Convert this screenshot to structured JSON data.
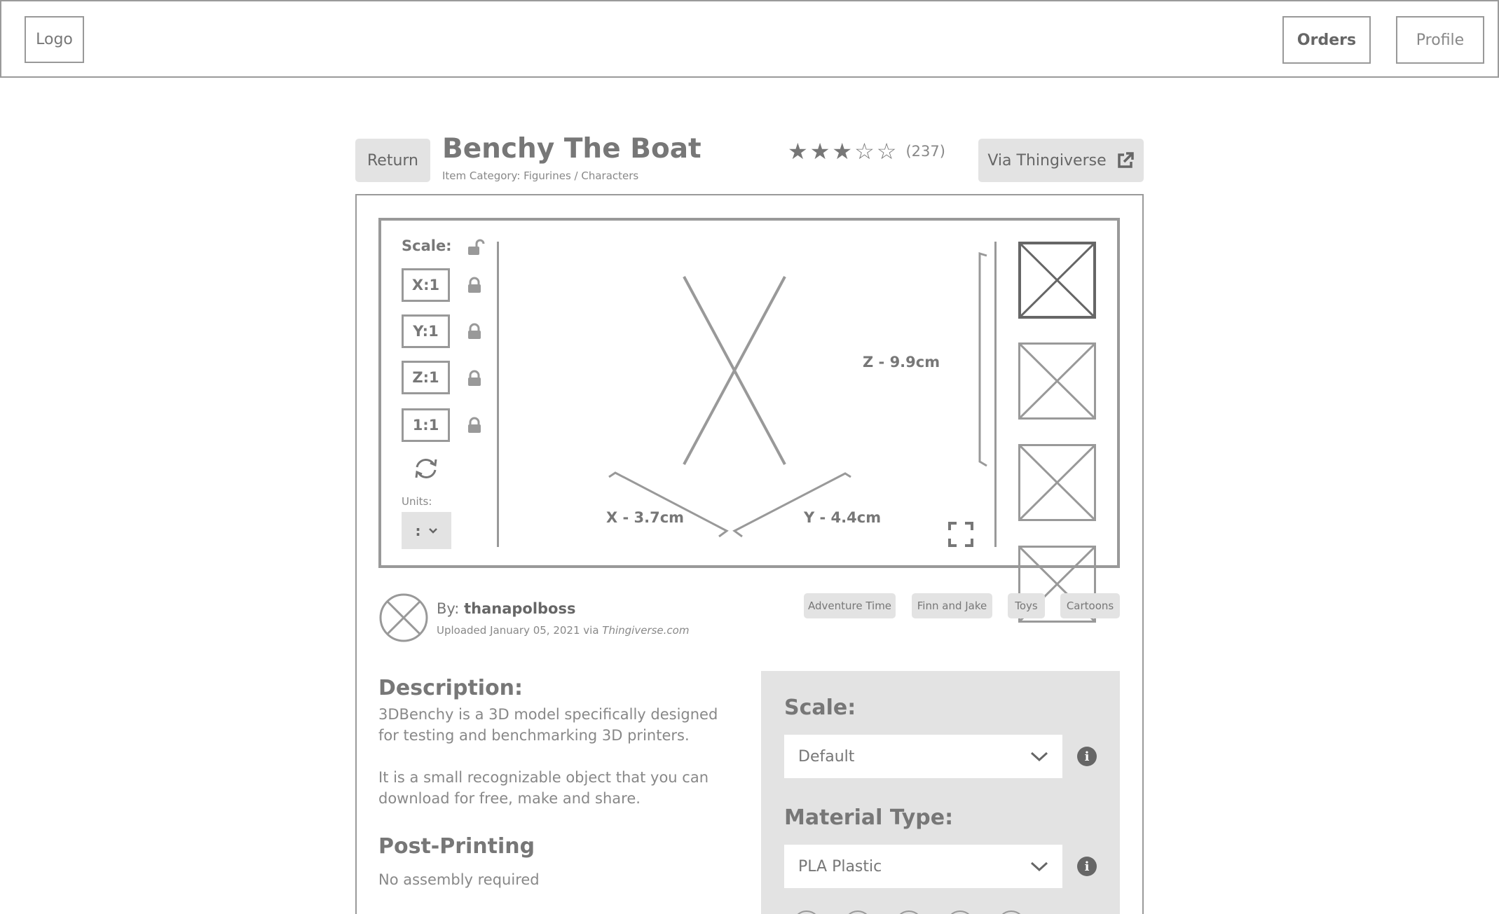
{
  "nav": {
    "logo": "Logo",
    "orders": "Orders",
    "profile": "Profile"
  },
  "product": {
    "return_label": "Return",
    "title": "Benchy The Boat",
    "category": "Item Category: Figurines / Characters",
    "rating": {
      "stars": 3,
      "max": 5,
      "count": "(237)"
    },
    "source_button": "Via Thingiverse"
  },
  "viewer": {
    "scale_label": "Scale:",
    "scale_boxes": [
      "X:1",
      "Y:1",
      "Z:1",
      "1:1"
    ],
    "units_label": "Units:",
    "units_value": ":",
    "dimensions": {
      "x": "X - 3.7cm",
      "y": "Y - 4.4cm",
      "z": "Z - 9.9cm"
    }
  },
  "author": {
    "by_prefix": "By:",
    "name": "thanapolboss",
    "uploaded_prefix": "Uploaded January 05, 2021 via",
    "site": "Thingiverse.com"
  },
  "tags": [
    "Adventure Time",
    "Finn and Jake",
    "Toys",
    "Cartoons"
  ],
  "description": {
    "heading": "Description:",
    "para1": "3DBenchy is a 3D model specifically designed for testing and benchmarking 3D printers.",
    "para2": "It is a small recognizable object that you can download for free, make and share.",
    "post_heading": "Post-Printing",
    "post_text": "No assembly required"
  },
  "config": {
    "scale_label": "Scale:",
    "scale_value": "Default",
    "material_label": "Material Type:",
    "material_value": "PLA Plastic"
  },
  "colors": {
    "accent_gray": "#777777",
    "chip_bg": "#e3e3e3",
    "border": "#999999"
  }
}
